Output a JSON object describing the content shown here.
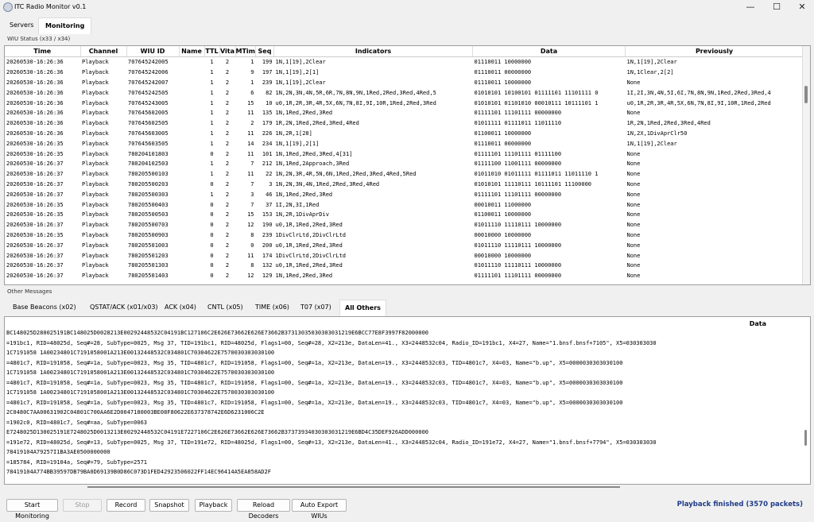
{
  "window": {
    "title": "ITC Radio Monitor v0.1",
    "controls": [
      "—",
      "☐",
      "✕"
    ]
  },
  "tabs": [
    "Servers",
    "Monitoring"
  ],
  "wiu_status": {
    "label": "WIU Status (x33 / x34)",
    "columns": [
      "Time",
      "Channel",
      "WIU ID",
      "Name",
      "TTL",
      "Vita",
      "MTim",
      "Seq",
      "Indicators",
      "Data",
      "Previously"
    ],
    "rows": [
      [
        "20260530-16:26:36",
        "Playback",
        "707645242005",
        "",
        "1",
        "2",
        "1",
        "199",
        "1N,1[19],2Clear",
        "01110011 10000000",
        "1N,1[19],2Clear"
      ],
      [
        "20260530-16:26:36",
        "Playback",
        "707645242006",
        "",
        "1",
        "2",
        "9",
        "197",
        "1N,1[19],2[1]",
        "01110011 00000000",
        "1N,1Clear,2[2]"
      ],
      [
        "20260530-16:26:36",
        "Playback",
        "707645242007",
        "",
        "1",
        "2",
        "1",
        "239",
        "1N,1[19],2Clear",
        "01110011 10000000",
        "None"
      ],
      [
        "20260530-16:26:36",
        "Playback",
        "707645242505",
        "",
        "1",
        "2",
        "6",
        "82",
        "1N,2N,3N,4N,5R,6R,7N,8N,9N,1Red,2Red,3Red,4Red,5",
        "01010101 10100101 01111101 11101111 0",
        "1I,2I,3N,4N,5I,6I,7N,8N,9N,1Red,2Red,3Red,4"
      ],
      [
        "20260530-16:26:36",
        "Playback",
        "707645243005",
        "",
        "1",
        "2",
        "15",
        "10",
        "u0,1R,2R,3R,4R,5X,6N,7N,8I,9I,10R,1Red,2Red,3Red",
        "01010101 01101010 00010111 10111101 1",
        "u0,1R,2R,3R,4R,5X,6N,7N,8I,9I,10R,1Red,2Red"
      ],
      [
        "20260530-16:26:36",
        "Playback",
        "707645602005",
        "",
        "1",
        "2",
        "11",
        "135",
        "1N,1Red,2Red,3Red",
        "01111101 11101111 00000000",
        "None"
      ],
      [
        "20260530-16:26:36",
        "Playback",
        "707645602505",
        "",
        "1",
        "2",
        "2",
        "179",
        "1R,2N,1Red,2Red,3Red,4Red",
        "01011111 01111011 11011110",
        "1R,2N,1Red,2Red,3Red,4Red"
      ],
      [
        "20260530-16:26:36",
        "Playback",
        "707645603005",
        "",
        "1",
        "2",
        "11",
        "226",
        "1N,2R,1[28]",
        "01100011 10000000",
        "1N,2X,1DivAprClr50"
      ],
      [
        "20260530-16:26:35",
        "Playback",
        "707645603505",
        "",
        "1",
        "2",
        "14",
        "234",
        "1N,1[19],2[1]",
        "01110011 00000000",
        "1N,1[19],2Clear"
      ],
      [
        "20260530-16:26:35",
        "Playback",
        "780204101803",
        "",
        "0",
        "2",
        "11",
        "101",
        "1N,1Red,2Red,3Red,4[31]",
        "01111101 11101111 01111100",
        "None"
      ],
      [
        "20260530-16:26:37",
        "Playback",
        "780204102503",
        "",
        "1",
        "2",
        "7",
        "212",
        "1N,1Red,2Approach,3Red",
        "01111100 11001111 00000000",
        "None"
      ],
      [
        "20260530-16:26:37",
        "Playback",
        "780205500103",
        "",
        "1",
        "2",
        "11",
        "22",
        "1N,2N,3R,4R,5N,6N,1Red,2Red,3Red,4Red,5Red",
        "01011010 01011111 01111011 11011110 1",
        "None"
      ],
      [
        "20260530-16:26:37",
        "Playback",
        "780205500203",
        "",
        "0",
        "2",
        "7",
        "3",
        "1N,2N,3N,4N,1Red,2Red,3Red,4Red",
        "01010101 11110111 10111101 11100000",
        "None"
      ],
      [
        "20260530-16:26:37",
        "Playback",
        "780205500303",
        "",
        "1",
        "2",
        "3",
        "46",
        "1N,1Red,2Red,3Red",
        "01111101 11101111 00000000",
        "None"
      ],
      [
        "20260530-16:26:35",
        "Playback",
        "780205500403",
        "",
        "0",
        "2",
        "7",
        "37",
        "1I,2N,3I,1Red",
        "00010011 11000000",
        "None"
      ],
      [
        "20260530-16:26:35",
        "Playback",
        "780205500503",
        "",
        "0",
        "2",
        "15",
        "153",
        "1N,2R,1DivAprDiv",
        "01100011 10000000",
        "None"
      ],
      [
        "20260530-16:26:37",
        "Playback",
        "780205500703",
        "",
        "0",
        "2",
        "12",
        "190",
        "u0,1R,1Red,2Red,3Red",
        "01011110 11110111 10000000",
        "None"
      ],
      [
        "20260530-16:26:35",
        "Playback",
        "780205500903",
        "",
        "0",
        "2",
        "8",
        "239",
        "1DivClrLtd,2DivClrLtd",
        "00010000 10000000",
        "None"
      ],
      [
        "20260530-16:26:37",
        "Playback",
        "780205501003",
        "",
        "0",
        "2",
        "0",
        "200",
        "u0,1R,1Red,2Red,3Red",
        "01011110 11110111 10000000",
        "None"
      ],
      [
        "20260530-16:26:37",
        "Playback",
        "780205501203",
        "",
        "0",
        "2",
        "11",
        "174",
        "1DivClrLtd,2DivClrLtd",
        "00010000 10000000",
        "None"
      ],
      [
        "20260530-16:26:37",
        "Playback",
        "780205501303",
        "",
        "0",
        "2",
        "8",
        "132",
        "u0,1R,1Red,2Red,3Red",
        "01011110 11110111 10000000",
        "None"
      ],
      [
        "20260530-16:26:37",
        "Playback",
        "780205501403",
        "",
        "0",
        "2",
        "12",
        "129",
        "1N,1Red,2Red,3Red",
        "01111101 11101111 00000000",
        "None"
      ]
    ]
  },
  "other_messages": {
    "label": "Other Messages",
    "tabs": [
      "Base Beacons (x02)",
      "QSTAT/ACK (x01/x03)",
      "ACK (x04)",
      "CNTL (x05)",
      "TIME (x06)",
      "T07 (x07)",
      "All Others"
    ],
    "column": "Data",
    "lines": [
      "BC148025D280025191BC148025D0028213E00292448532C04191BC127106C2E626E73662E626E73662B37313035030303031219E6BCC77E8F3997F82000000",
      "=191bc1, RID=48025d, Seq#=28, SubType=0025, Msg 37, TID=191bc1, RID=48025d, Flags1=00, Seq#=28, X2=213e, DataLen=41., X3=2448532c04, Radio_ID=191bc1, X4=27, Name=\"1.bnsf.bnsf+7105\", X5=030303030",
      "1C7191058 1A00234801C7191058001A213E00132448532C034801C70304622E7570030303030100",
      "=4801c7, RID=191058, Seq#=1a, SubType=0023, Msg 35, TID=4801c7, RID=191058, Flags1=00, Seq#=1a, X2=213e, DataLen=19., X3=2448532c03, TID=4801c7, X4=03, Name=\"b.up\", X5=0000030303030100",
      "1C7191058 1A00234801C7191058001A213E00132448532C034801C70304622E7570030303030100",
      "=4801c7, RID=191058, Seq#=1a, SubType=0023, Msg 35, TID=4801c7, RID=191058, Flags1=00, Seq#=1a, X2=213e, DataLen=19., X3=2448532c03, TID=4801c7, X4=03, Name=\"b.up\", X5=0000030303030100",
      "1C7191058 1A00234801C7191058001A213E00132448532C034801C70304622E7570030303030100",
      "=4801c7, RID=191058, Seq#=1a, SubType=0023, Msg 35, TID=4801c7, RID=191058, Flags1=00, Seq#=1a, X2=213e, DataLen=19., X3=2448532c03, TID=4801c7, X4=03, Name=\"b.up\", X5=0000030303030100",
      "2C0480C7AA00631902C04801C700AA6E2D0047180003BE08F80622E637378742E6D6231006C2E",
      "=1902c0, RID=4801c7, Seq#=aa, SubType=0063",
      "E7248025D130025191E7248025D0013213E00292448532C04191E7227106C2E626E73662E626E73662B37373934030303031219E6BD4C35DEF926ADD000000",
      "=191e72, RID=48025d, Seq#=13, SubType=0025, Msg 37, TID=191e72, RID=48025d, Flags1=00, Seq#=13, X2=213e, DataLen=41., X3=2448532c04, Radio_ID=191e72, X4=27, Name=\"1.bnsf.bnsf+7794\", X5=030303030",
      "78419104A79257I1BA3AE0500000000",
      "=185784, RID=19104a, Seq#=79, SubType=2571",
      "78419104A774BB39597DB79BA0D69139B0D86C073D1FED42923506022FF14EC96414A5EA858AD2F"
    ]
  },
  "toolbar": {
    "buttons": [
      "Start Monitoring",
      "Stop",
      "Record",
      "Snapshot",
      "Playback",
      "Reload Decoders",
      "Auto Export WIUs"
    ]
  },
  "status": {
    "text": "Playback finished (3570 packets)",
    "color": "#1f3c88"
  }
}
